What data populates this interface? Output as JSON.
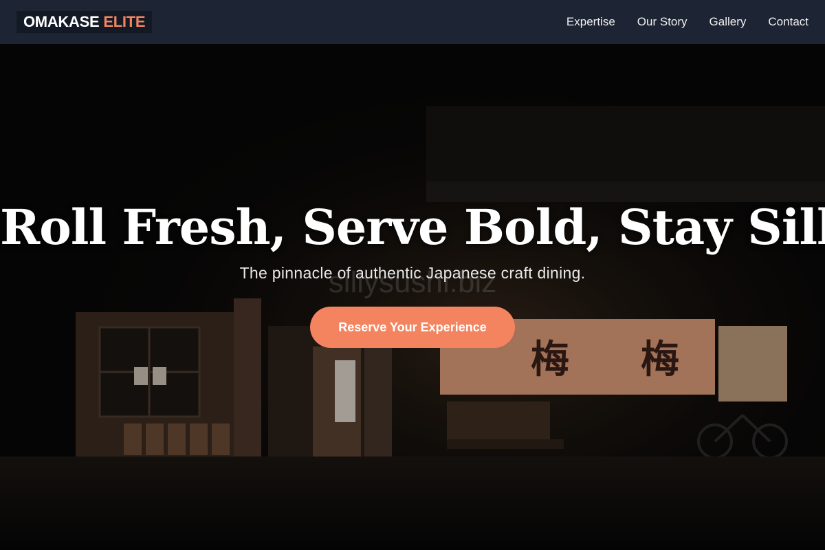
{
  "brand": {
    "word1": "OMAKASE",
    "word2": "ELITE",
    "accent_color": "#f4845f"
  },
  "nav": {
    "links": [
      {
        "label": "Expertise"
      },
      {
        "label": "Our Story"
      },
      {
        "label": "Gallery"
      },
      {
        "label": "Contact"
      }
    ]
  },
  "hero": {
    "title": "Roll Fresh, Serve Bold, Stay Silly.",
    "subtitle": "The pinnacle of authentic Japanese craft dining.",
    "cta_label": "Reserve Your Experience",
    "watermark": "sillysushi.biz",
    "sign_characters": [
      "梅",
      "梅"
    ],
    "background": "restaurant-storefront-night-photo"
  },
  "colors": {
    "nav_bg": "#1d2434",
    "accent": "#f4845f"
  }
}
